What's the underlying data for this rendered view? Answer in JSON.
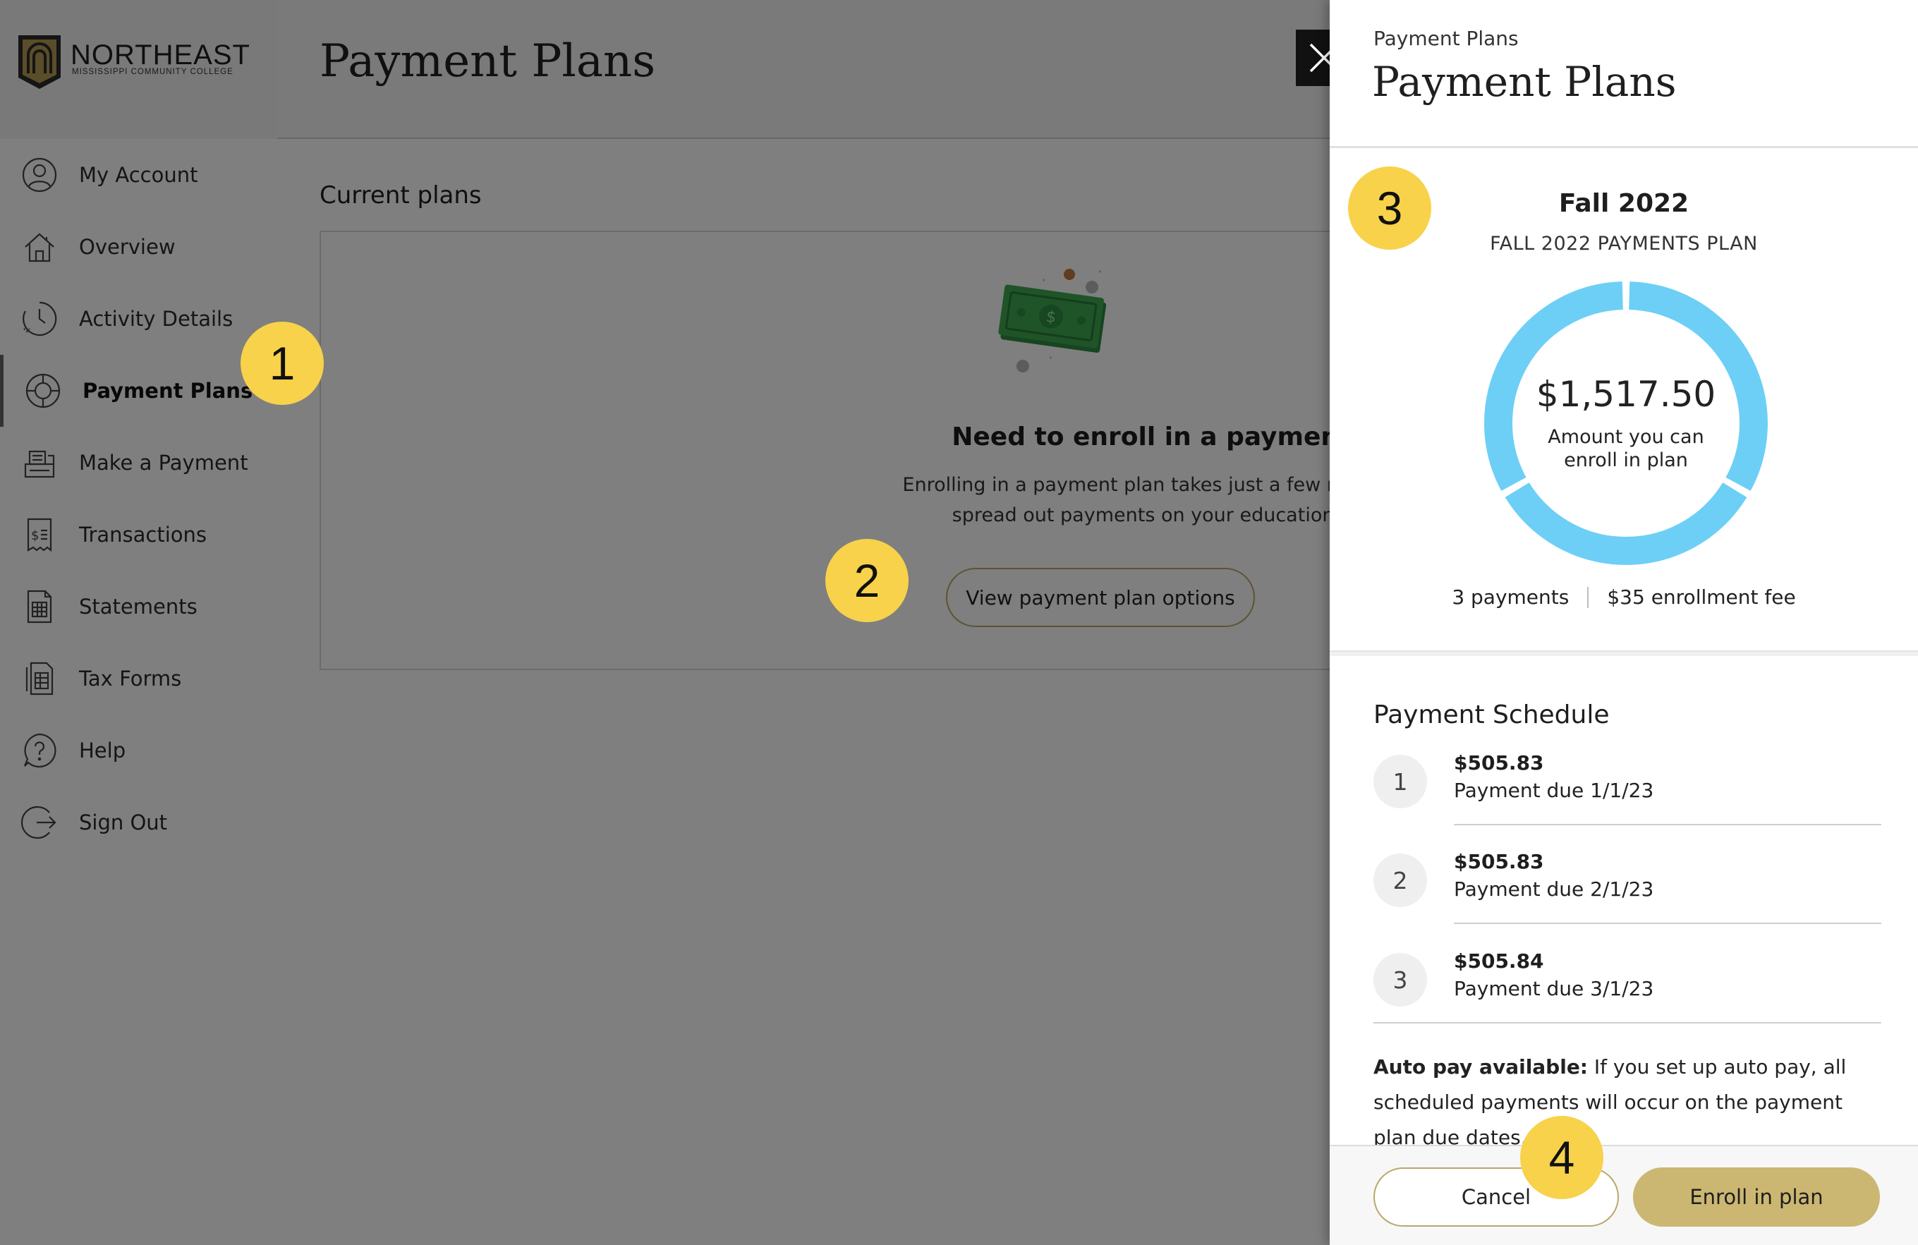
{
  "brand": {
    "name": "NORTHEAST",
    "subtitle": "MISSISSIPPI COMMUNITY COLLEGE"
  },
  "header": {
    "title": "Payment Plans"
  },
  "sidebar": {
    "items": [
      {
        "label": "My Account",
        "icon": "user-circle-icon"
      },
      {
        "label": "Overview",
        "icon": "home-icon"
      },
      {
        "label": "Activity Details",
        "icon": "clock-icon"
      },
      {
        "label": "Payment Plans",
        "icon": "lifebuoy-icon",
        "active": true
      },
      {
        "label": "Make a Payment",
        "icon": "cash-register-icon"
      },
      {
        "label": "Transactions",
        "icon": "receipt-icon"
      },
      {
        "label": "Statements",
        "icon": "statement-icon"
      },
      {
        "label": "Tax Forms",
        "icon": "tax-form-icon"
      },
      {
        "label": "Help",
        "icon": "help-icon"
      },
      {
        "label": "Sign Out",
        "icon": "sign-out-icon"
      }
    ]
  },
  "main": {
    "current_plans_heading": "Current plans",
    "empty_state": {
      "illustration": "money-icon",
      "heading": "Need to enroll in a payment plan?",
      "description_line_1": "Enrolling in a payment plan takes just a few minutes and can",
      "description_line_2": "spread out payments on your education expenses.",
      "button_label": "View payment plan options"
    }
  },
  "drawer": {
    "eyebrow": "Payment Plans",
    "title": "Payment Plans",
    "plan": {
      "term": "Fall 2022",
      "name": "FALL 2022 PAYMENTS PLAN",
      "amount": "$1,517.50",
      "amount_caption_line_1": "Amount you can",
      "amount_caption_line_2": "enroll in plan",
      "payments_count": "3 payments",
      "enrollment_fee": "$35 enrollment fee",
      "donut_segments": 3,
      "donut_color": "#6dcff6"
    },
    "schedule": {
      "heading": "Payment Schedule",
      "payments": [
        {
          "number": "1",
          "amount": "$505.83",
          "due": "Payment due 1/1/23"
        },
        {
          "number": "2",
          "amount": "$505.83",
          "due": "Payment due 2/1/23"
        },
        {
          "number": "3",
          "amount": "$505.84",
          "due": "Payment due 3/1/23"
        }
      ]
    },
    "autopay": {
      "label": "Auto pay available:",
      "text": " If you set up auto pay, all scheduled payments will occur on the payment plan due dates."
    },
    "footer": {
      "cancel_label": "Cancel",
      "enroll_label": "Enroll in plan"
    }
  },
  "callouts": [
    "1",
    "2",
    "3",
    "4"
  ],
  "colors": {
    "accent_gold": "#cbb772",
    "callout_yellow": "#f7d24a",
    "donut_blue": "#6dcff6",
    "overlay": "rgba(0,0,0,0.5)"
  }
}
